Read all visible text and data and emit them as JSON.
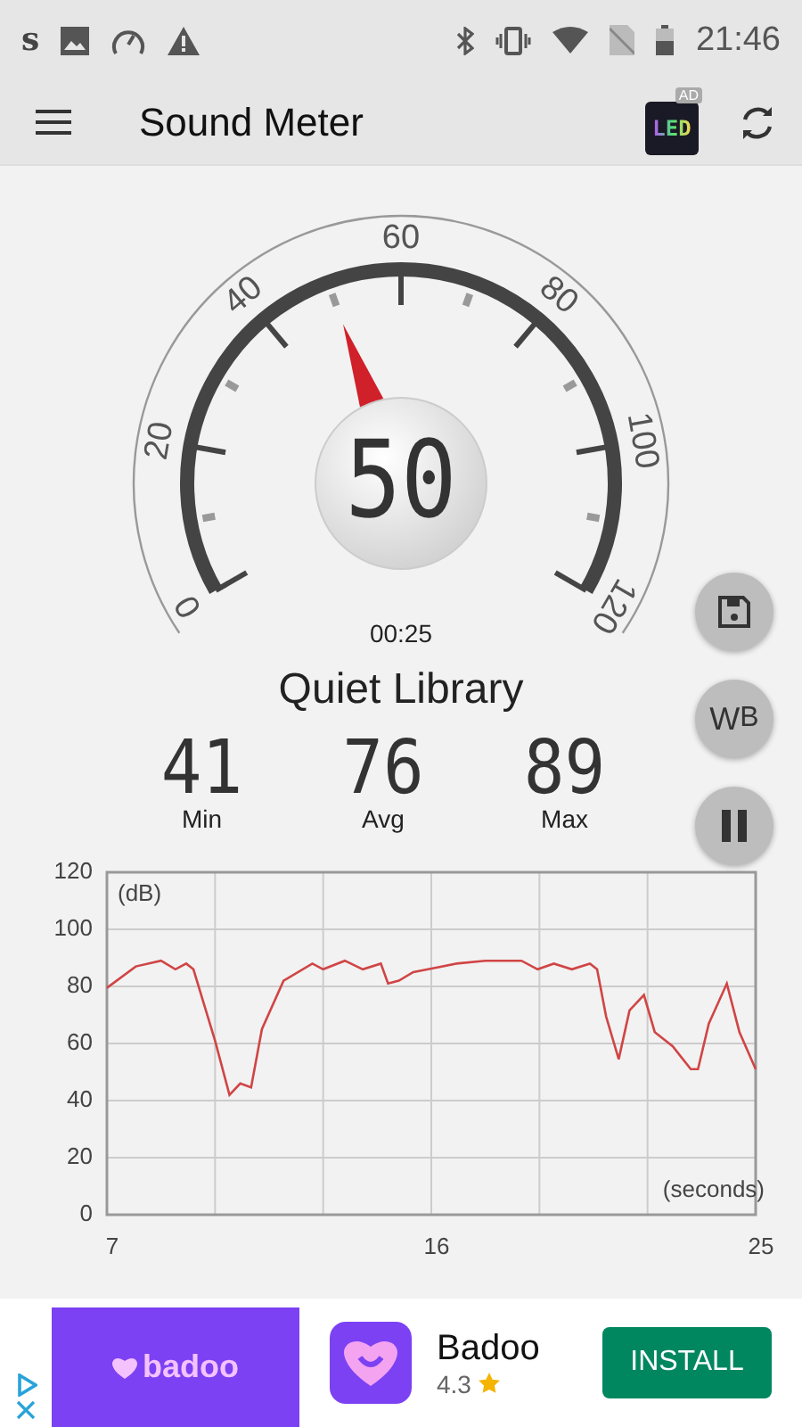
{
  "status_bar": {
    "app_letter": "s",
    "time": "21:46"
  },
  "toolbar": {
    "title": "Sound Meter",
    "ad_app": {
      "label": "LED",
      "badge": "AD"
    }
  },
  "gauge": {
    "reading": "50",
    "scale_labels": [
      "0",
      "20",
      "40",
      "60",
      "80",
      "100",
      "120"
    ],
    "elapsed": "00:25"
  },
  "side_buttons": [
    {
      "kind": "save"
    },
    {
      "kind": "weighting",
      "label": "W",
      "sub": "B"
    },
    {
      "kind": "pause"
    }
  ],
  "environment": "Quiet Library",
  "stats": [
    {
      "value": "41",
      "label": "Min"
    },
    {
      "value": "76",
      "label": "Avg"
    },
    {
      "value": "89",
      "label": "Max"
    }
  ],
  "chart": {
    "chart_data": {
      "type": "line",
      "xlabel": "(seconds)",
      "ylabel": "(dB)",
      "xlim": [
        7,
        25
      ],
      "ylim": [
        0,
        120
      ],
      "xticks": [
        7,
        16,
        25
      ],
      "grid": true,
      "yticks": [
        0,
        20,
        40,
        60,
        80,
        100,
        120
      ],
      "x": [
        7,
        7.8,
        8.5,
        8.9,
        9.2,
        9.4,
        10,
        10.4,
        10.7,
        11,
        11.3,
        11.9,
        12.7,
        13,
        13.6,
        14.1,
        14.6,
        14.8,
        15.1,
        15.5,
        16.1,
        16.7,
        17.5,
        18.5,
        18.95,
        19.4,
        19.9,
        20.4,
        20.6,
        20.85,
        21.2,
        21.5,
        21.9,
        22.2,
        22.7,
        23.2,
        23.4,
        23.7,
        24.2,
        24.55,
        25
      ],
      "series": [
        {
          "color": "#d04545",
          "values": [
            79.5,
            87,
            89,
            86,
            88,
            86,
            61,
            42,
            46,
            44.6,
            65,
            82,
            88,
            86,
            89,
            86,
            88,
            81,
            82,
            85,
            86.5,
            88,
            89,
            89,
            86,
            88,
            86,
            88,
            86,
            69.5,
            54.5,
            71.6,
            77,
            64,
            59,
            51,
            51,
            67,
            81,
            64,
            51
          ]
        }
      ]
    }
  },
  "ad": {
    "banner_text": "badoo",
    "app_name": "Badoo",
    "rating": "4.3",
    "button": "INSTALL"
  }
}
